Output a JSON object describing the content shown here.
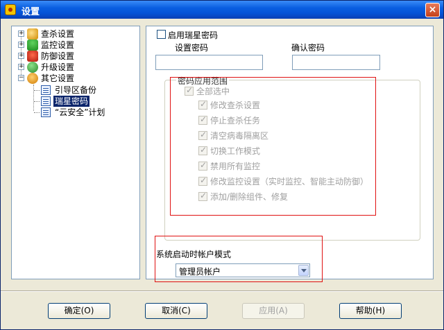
{
  "window": {
    "title": "设置",
    "close_glyph": "×"
  },
  "tree": {
    "items": [
      {
        "label": "查杀设置",
        "icon": "scan-icon"
      },
      {
        "label": "监控设置",
        "icon": "umbrella-icon"
      },
      {
        "label": "防御设置",
        "icon": "shield-icon"
      },
      {
        "label": "升级设置",
        "icon": "update-icon"
      },
      {
        "label": "其它设置",
        "icon": "gear-icon"
      }
    ],
    "children": [
      {
        "label": "引导区备份"
      },
      {
        "label": "瑞星密码"
      },
      {
        "label": "“云安全”计划"
      }
    ],
    "expander_plus": "+",
    "expander_minus": "−"
  },
  "password": {
    "enable_label": "启用瑞星密码",
    "set_label": "设置密码",
    "confirm_label": "确认密码",
    "set_value": "",
    "confirm_value": ""
  },
  "scope": {
    "title": "密码应用范围",
    "select_all": "全部选中",
    "options": [
      "修改查杀设置",
      "停止查杀任务",
      "清空病毒隔离区",
      "切换工作模式",
      "禁用所有监控",
      "修改监控设置（实时监控、智能主动防御）",
      "添加/删除组件、修复"
    ]
  },
  "startup": {
    "label": "系统启动时帐户模式",
    "selected": "管理员帐户"
  },
  "buttons": {
    "ok": "确定(O)",
    "cancel": "取消(C)",
    "apply": "应用(A)",
    "help": "帮助(H)"
  },
  "colors": {
    "titlebar": "#0553d6",
    "highlight": "#e01010",
    "selection": "#0a246a"
  }
}
